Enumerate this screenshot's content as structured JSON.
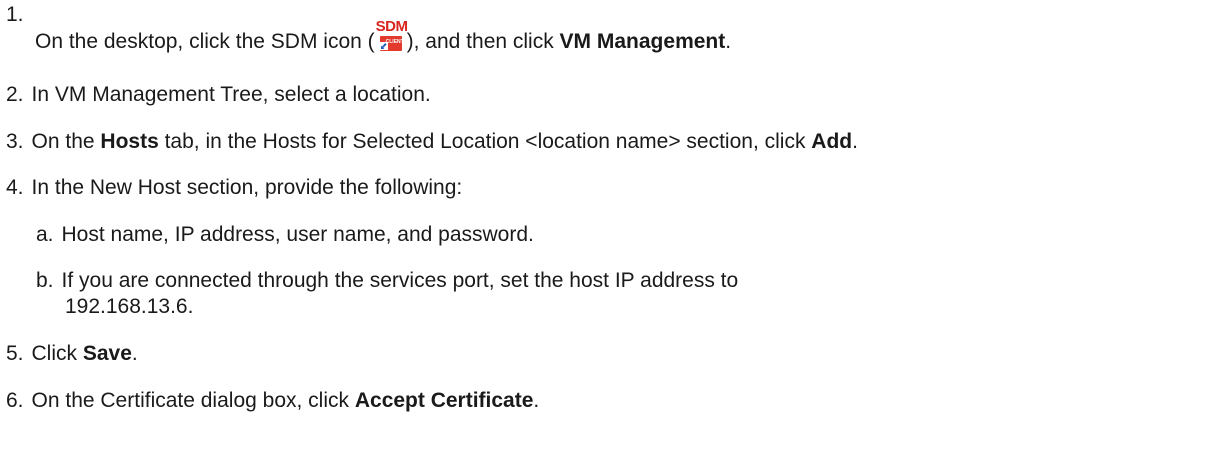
{
  "steps": [
    {
      "num": "1.",
      "pre": "On the desktop, click the SDM icon (",
      "icon_name": "sdm-client-icon",
      "icon_label_top": "SDM",
      "icon_label_box": "CLIENT",
      "mid": "), and then click ",
      "bold": "VM Management",
      "post": "."
    },
    {
      "num": "2.",
      "text": "In VM Management Tree, select a location."
    },
    {
      "num": "3.",
      "pre": "On the ",
      "bold1": "Hosts",
      "mid": " tab, in the Hosts for Selected Location <location name> section, click ",
      "bold2": "Add",
      "post": "."
    },
    {
      "num": "4.",
      "text": "In the New Host section, provide the following:",
      "substeps": [
        {
          "letter": "a.",
          "text": "Host name, IP address, user name, and password."
        },
        {
          "letter": "b.",
          "line1": "If you are connected through the services port, set the host IP address to",
          "line2": "192.168.13.6."
        }
      ]
    },
    {
      "num": "5.",
      "pre": "Click ",
      "bold": "Save",
      "post": "."
    },
    {
      "num": "6.",
      "pre": "On the Certificate dialog box, click ",
      "bold": "Accept Certificate",
      "post": "."
    }
  ]
}
